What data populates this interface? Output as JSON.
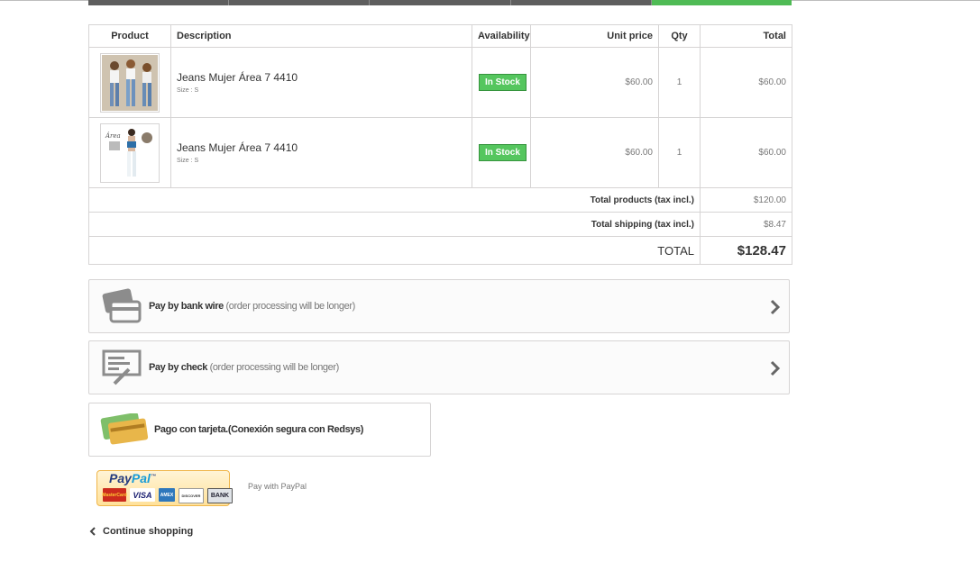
{
  "table": {
    "headers": {
      "product": "Product",
      "description": "Description",
      "availability": "Availability",
      "unit_price": "Unit price",
      "qty": "Qty",
      "total": "Total"
    },
    "rows": [
      {
        "name": "Jeans Mujer Área 7 4410",
        "size": "Size : S",
        "availability": "In Stock",
        "unit_price": "$60.00",
        "qty": "1",
        "total": "$60.00"
      },
      {
        "name": "Jeans Mujer Área 7 4410",
        "size": "Size : S",
        "availability": "In Stock",
        "unit_price": "$60.00",
        "qty": "1",
        "total": "$60.00"
      }
    ],
    "summary": {
      "products_label": "Total products (tax incl.)",
      "products_value": "$120.00",
      "shipping_label": "Total shipping (tax incl.)",
      "shipping_value": "$8.47",
      "total_label": "TOTAL",
      "total_value": "$128.47"
    }
  },
  "payment": {
    "bank_wire": {
      "title": "Pay by bank wire",
      "note": " (order processing will be longer)"
    },
    "check": {
      "title": "Pay by check",
      "note": " (order processing will be longer)"
    },
    "card": {
      "title": "Pago con tarjeta.(Conexión segura con Redsys)"
    },
    "paypal": {
      "logo_text_pay": "Pay",
      "logo_text_pal": "Pal",
      "logo_tm": "™",
      "cards": [
        "MasterCard",
        "VISA",
        "AMEX",
        "DISCOVER",
        "BANK"
      ],
      "label": "Pay with PayPal"
    }
  },
  "continue_shopping": "Continue shopping",
  "colors": {
    "stock_green": "#55c65e",
    "progress_done": "#4fbb55",
    "progress_pending": "#5e5e5e",
    "paypal_blue": "#253b80",
    "paypal_light_blue": "#179bd7"
  },
  "icons": {
    "bank_wire": "bank-wire-icon",
    "check": "check-icon",
    "card": "credit-cards-icon",
    "chevron": "chevron-right-icon",
    "continue": "chevron-left-icon"
  },
  "progress_steps": {
    "total": 5,
    "completed": 5,
    "current": 5
  }
}
